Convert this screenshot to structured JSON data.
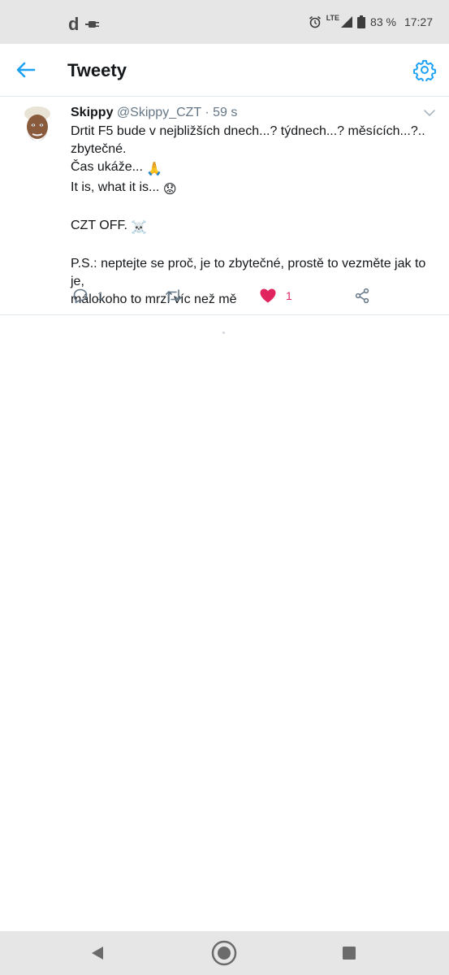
{
  "status_bar": {
    "app_letter": "d",
    "network": "LTE",
    "battery": "83 %",
    "time": "17:27"
  },
  "app_bar": {
    "title": "Tweety",
    "back_icon": "arrow-left-icon",
    "settings_icon": "gear-icon"
  },
  "tweet": {
    "name": "Skippy",
    "handle": "@Skippy_CZT",
    "separator": "·",
    "time": "59 s",
    "lines": [
      "Drtit F5 bude v nejbližších dnech...? týdnech...? měsících...?..",
      "zbytečné.",
      "Čas ukáže...",
      "It is, what it is...",
      "CZT OFF.",
      "P.S.: neptejte se proč, je to zbytečné, prostě to vezměte jak to je,",
      "málokoho to mrzí víc než mě"
    ],
    "emojis": {
      "line3": "🙏",
      "line4": "😟",
      "line5": "☠️"
    },
    "actions": {
      "reply_count": "1",
      "retweet_count": "",
      "like_count": "1",
      "liked": true
    }
  },
  "colors": {
    "accent": "#1da1f2",
    "like": "#e0245e",
    "muted": "#657786",
    "text": "#14171a",
    "system_bar": "#e6e6e6"
  },
  "nav_bar": {
    "back_icon": "triangle-back-icon",
    "home_icon": "circle-home-icon",
    "recents_icon": "square-recents-icon"
  }
}
